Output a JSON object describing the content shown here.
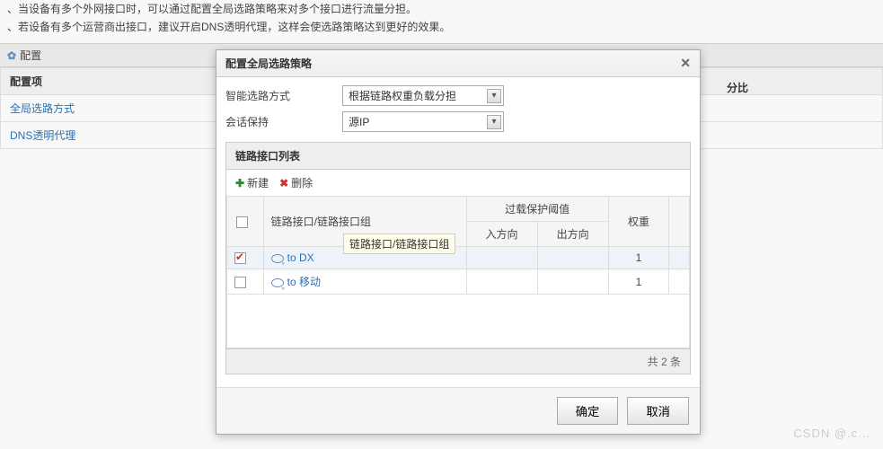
{
  "context": {
    "line1": "、当设备有多个外网接口时，可以通过配置全局选路策略来对多个接口进行流量分担。",
    "line2": "、若设备有多个运营商出接口，建议开启DNS透明代理，这样会使选路策略达到更好的效果。",
    "config_label": "配置"
  },
  "left_table": {
    "header": "配置项",
    "rows": [
      "全局选路方式",
      "DNS透明代理"
    ]
  },
  "header_right_fragment": "分比",
  "modal": {
    "title": "配置全局选路策略",
    "form": {
      "routing_label": "智能选路方式",
      "routing_value": "根据链路权重负载分担",
      "session_label": "会话保持",
      "session_value": "源IP"
    },
    "panel": {
      "title": "链路接口列表",
      "toolbar": {
        "add": "新建",
        "delete": "删除"
      },
      "columns": {
        "interface": "链路接口/链路接口组",
        "overload": "过载保护阈值",
        "in_dir": "入方向",
        "out_dir": "出方向",
        "weight": "权重"
      },
      "tooltip": "链路接口/链路接口组",
      "rows": [
        {
          "checked": true,
          "name": "to DX",
          "in": "",
          "out": "",
          "weight": "1"
        },
        {
          "checked": false,
          "name": "to 移动",
          "in": "",
          "out": "",
          "weight": "1"
        }
      ],
      "footer": "共 2 条"
    },
    "buttons": {
      "ok": "确定",
      "cancel": "取消"
    }
  },
  "watermark": "CSDN @.c..."
}
